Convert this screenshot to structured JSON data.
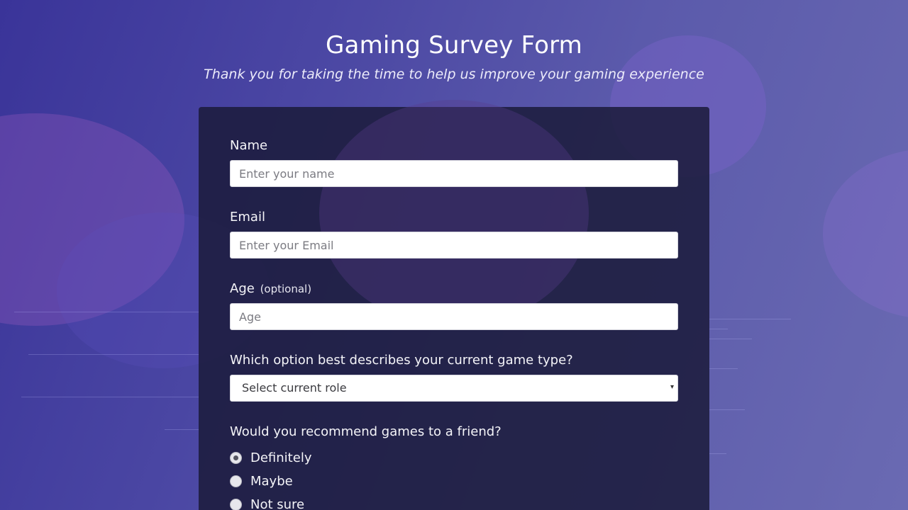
{
  "header": {
    "title": "Gaming Survey Form",
    "subtitle": "Thank you for taking the time to help us improve your gaming experience"
  },
  "form": {
    "name": {
      "label": "Name",
      "placeholder": "Enter your name",
      "value": ""
    },
    "email": {
      "label": "Email",
      "placeholder": "Enter your Email",
      "value": ""
    },
    "age": {
      "label": "Age",
      "hint": "(optional)",
      "placeholder": "Age",
      "value": ""
    },
    "game_type": {
      "label": "Which option best describes your current game type?",
      "selected": "Select current role"
    },
    "recommend": {
      "label": "Would you recommend games to a friend?",
      "options": [
        {
          "label": "Definitely",
          "checked": true
        },
        {
          "label": "Maybe",
          "checked": false
        },
        {
          "label": "Not sure",
          "checked": false
        }
      ]
    }
  },
  "icons": {
    "select_arrow": "chevron-down-icon"
  }
}
